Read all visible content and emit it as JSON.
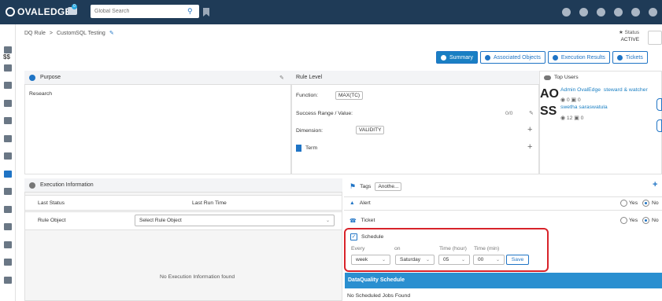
{
  "app": {
    "logo_text": "OVALEDGE",
    "chat_badge": "0"
  },
  "search": {
    "placeholder": "Global Search"
  },
  "breadcrumb": {
    "root": "DQ Rule",
    "separator": ">",
    "current": "CustomSQL Testing"
  },
  "status": {
    "label": "Status",
    "value": "ACTIVE"
  },
  "tabs": [
    "Summary",
    "Associated Objects",
    "Execution Results",
    "Tickets"
  ],
  "purpose": {
    "title": "Purpose",
    "text": "Research"
  },
  "rule_level": {
    "title": "Rule Level",
    "function_label": "Function:",
    "function_value": "MAX(TC)",
    "success_label": "Success Range / Value:",
    "success_value": "0/0",
    "dimension_label": "Dimension:",
    "dimension_value": "VALIDITY",
    "term_label": "Term"
  },
  "top_users": {
    "title": "Top Users",
    "users": [
      {
        "initials": "AO",
        "name": "Admin OvalEdge",
        "role": "steward & watcher",
        "views": "0",
        "comments": "0"
      },
      {
        "initials": "SS",
        "name": "swetha saraswatula",
        "role": "",
        "views": "12",
        "comments": "0"
      }
    ]
  },
  "execution": {
    "title": "Execution Information",
    "last_status": "Last Status",
    "last_run_time": "Last Run Time",
    "rule_object_label": "Rule Object",
    "rule_object_select": "Select Rule Object",
    "empty": "No Execution Information found"
  },
  "tags": {
    "title": "Tags",
    "chip": "Anothe..."
  },
  "alert": {
    "label": "Alert",
    "yes": "Yes",
    "no": "No"
  },
  "ticket": {
    "label": "Ticket",
    "yes": "Yes",
    "no": "No"
  },
  "schedule": {
    "label": "Schedule",
    "every_label": "Every",
    "on_label": "on",
    "hour_label": "Time (hour)",
    "min_label": "Time (min)",
    "every_value": "week",
    "on_value": "Saturday",
    "hour_value": "05",
    "min_value": "00",
    "save": "Save"
  },
  "dq_schedule": {
    "title": "DataQuality Schedule",
    "empty": "No Scheduled Jobs Found"
  },
  "colors": {
    "topbar": "#1f3b57",
    "accent": "#1a7fc3",
    "highlight": "#d8232a"
  }
}
